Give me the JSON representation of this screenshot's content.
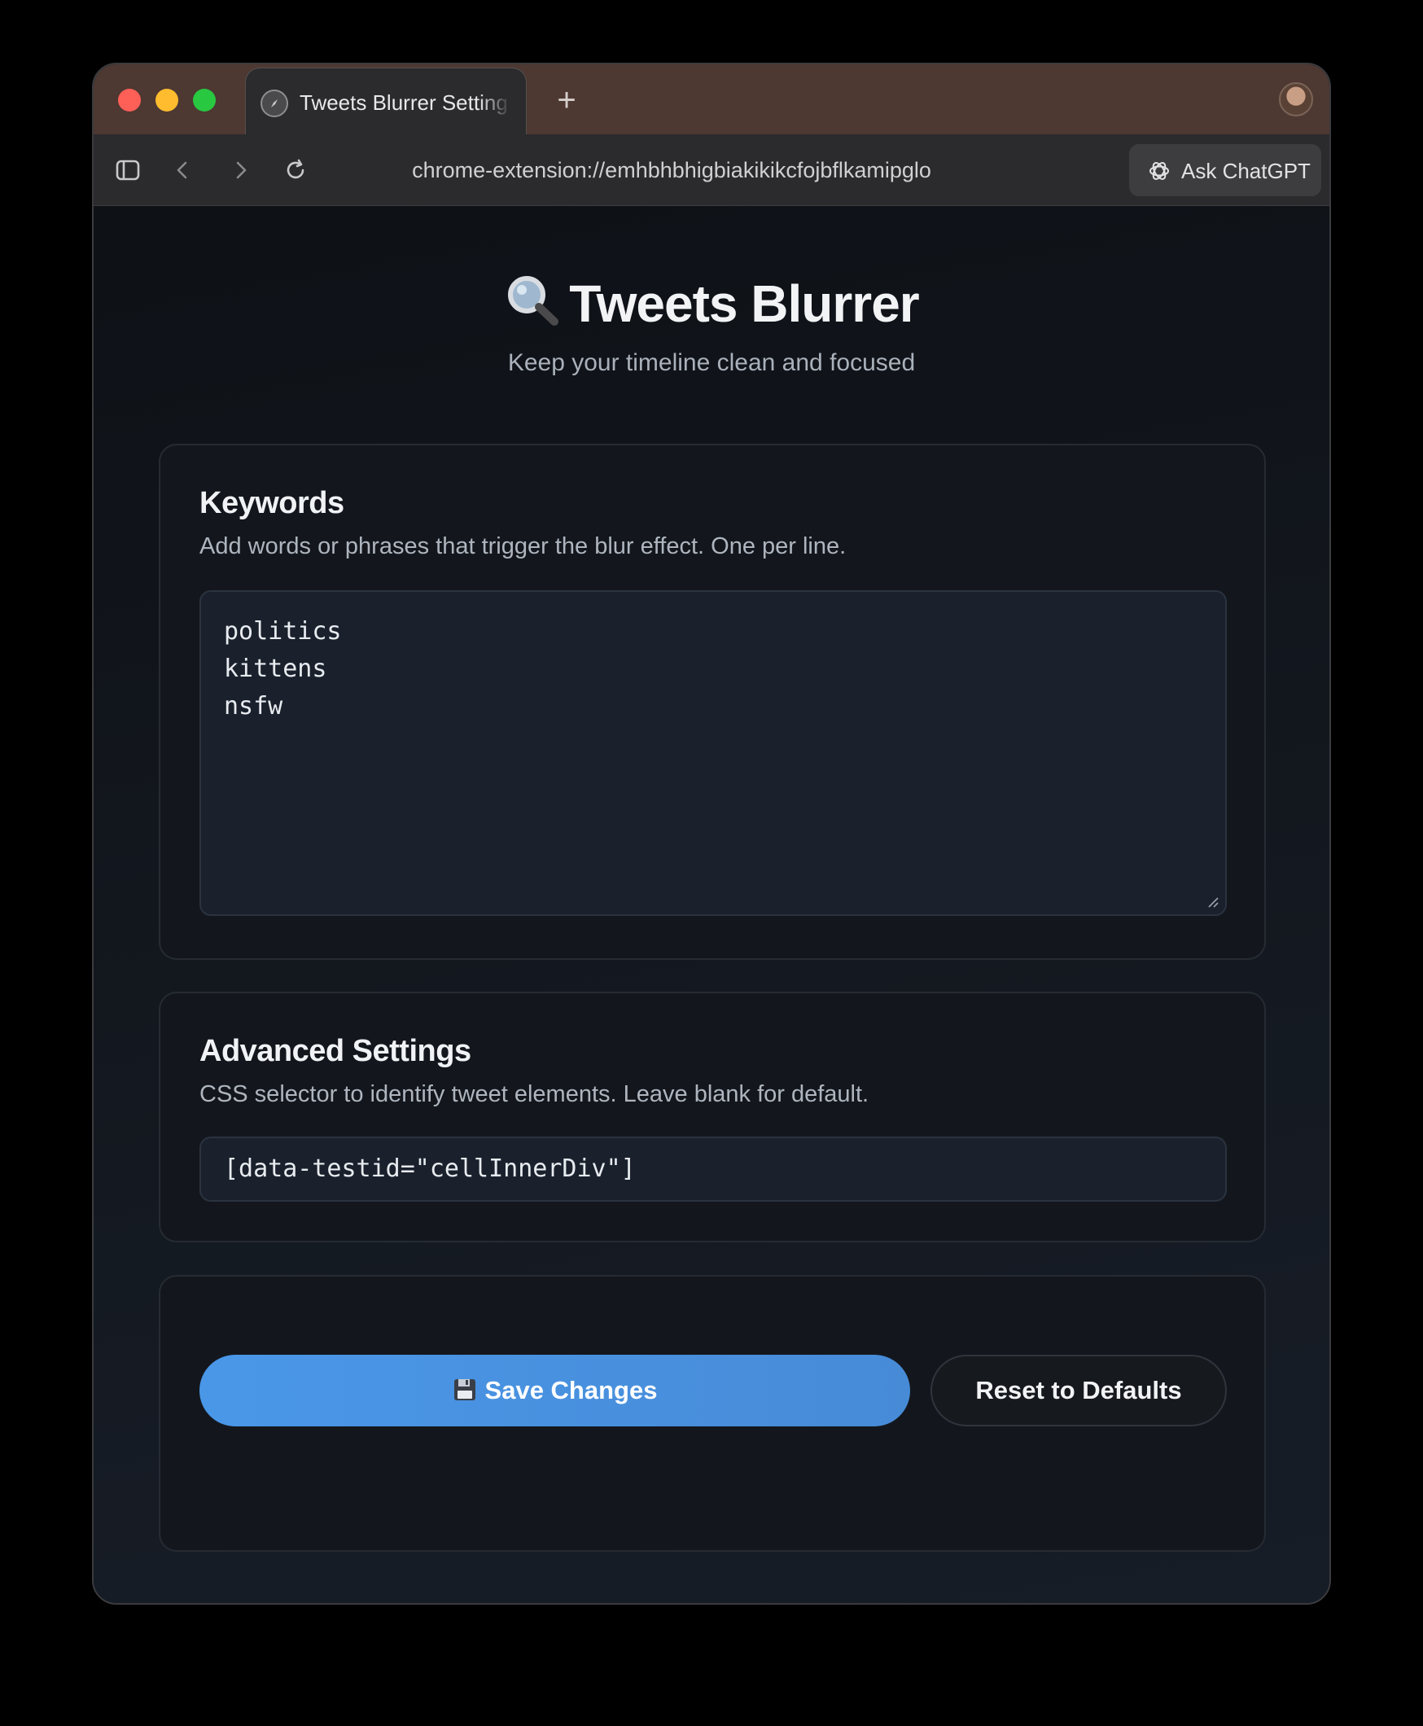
{
  "browser": {
    "tab_title": "Tweets Blurrer Settings",
    "new_tab_symbol": "+",
    "url": "chrome-extension://emhbhbhigbiakikikcfojbflkamipglo",
    "ask_button_label": "Ask ChatGPT"
  },
  "page": {
    "title": "Tweets Blurrer",
    "title_icon": "magnifying-glass-emoji",
    "subtitle": "Keep your timeline clean and focused"
  },
  "keywords": {
    "heading": "Keywords",
    "description": "Add words or phrases that trigger the blur effect. One per line.",
    "lines": [
      "politics",
      "kittens",
      "nsfw"
    ]
  },
  "advanced": {
    "heading": "Advanced Settings",
    "description": "CSS selector to identify tweet elements. Leave blank for default.",
    "selector_value": "[data-testid=\"cellInnerDiv\"]"
  },
  "actions": {
    "save_label": "Save Changes",
    "save_icon": "floppy-disk-emoji",
    "reset_label": "Reset to Defaults"
  },
  "colors": {
    "accent": "#4a97e8",
    "background": "#12161d",
    "tab_bar": "#4d3832"
  }
}
